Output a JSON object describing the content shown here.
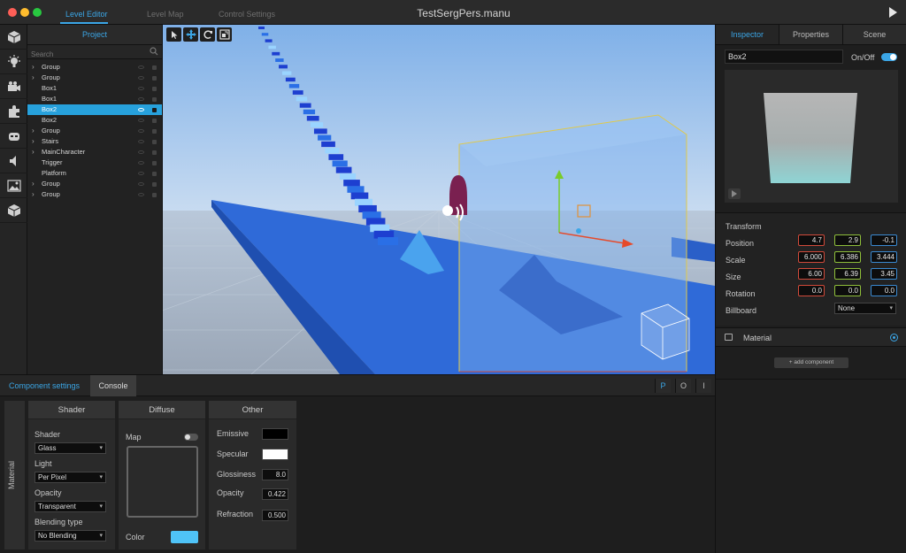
{
  "window": {
    "title": "TestSergPers.manu",
    "tabs": [
      "Level Editor",
      "Level Map",
      "Control Settings"
    ]
  },
  "project": {
    "header": "Project",
    "search_placeholder": "Search",
    "items": [
      {
        "label": "Group",
        "expandable": true
      },
      {
        "label": "Group",
        "expandable": true
      },
      {
        "label": "Box1",
        "expandable": false
      },
      {
        "label": "Box1",
        "expandable": false
      },
      {
        "label": "Box2",
        "expandable": false,
        "selected": true
      },
      {
        "label": "Box2",
        "expandable": false
      },
      {
        "label": "Group",
        "expandable": true
      },
      {
        "label": "Stairs",
        "expandable": true
      },
      {
        "label": "MainCharacter",
        "expandable": true
      },
      {
        "label": "Trigger",
        "expandable": false
      },
      {
        "label": "Platform",
        "expandable": false
      },
      {
        "label": "Group",
        "expandable": true
      },
      {
        "label": "Group",
        "expandable": true
      }
    ]
  },
  "inspector": {
    "tabs": [
      "Inspector",
      "Properties",
      "Scene"
    ],
    "object_name": "Box2",
    "onoff_label": "On/Off",
    "enabled": true,
    "transform": {
      "title": "Transform",
      "position_label": "Position",
      "scale_label": "Scale",
      "size_label": "Size",
      "rotation_label": "Rotation",
      "billboard_label": "Billboard",
      "position": [
        "4.7",
        "2.9",
        "-0.1"
      ],
      "scale": [
        "6.000",
        "6.386",
        "3.444"
      ],
      "size": [
        "6.00",
        "6.39",
        "3.45"
      ],
      "rotation": [
        "0.0",
        "0.0",
        "0.0"
      ],
      "billboard": "None"
    },
    "component": "Material",
    "add_component_label": "+ add component"
  },
  "bottom": {
    "tabs": [
      "Component settings",
      "Console"
    ],
    "modes": [
      "P",
      "O",
      "I"
    ],
    "side_label": "Material",
    "shader": {
      "header": "Shader",
      "shader_label": "Shader",
      "shader_value": "Glass",
      "light_label": "Light",
      "light_value": "Per Pixel",
      "opacity_label": "Opacity",
      "opacity_value": "Transparent",
      "blending_label": "Blending type",
      "blending_value": "No Blending"
    },
    "diffuse": {
      "header": "Diffuse",
      "map_label": "Map",
      "color_label": "Color",
      "color_value": "#4fc3f7"
    },
    "other": {
      "header": "Other",
      "emissive_label": "Emissive",
      "emissive_color": "#000000",
      "specular_label": "Specular",
      "specular_color": "#ffffff",
      "glossiness_label": "Glossiness",
      "glossiness_value": "8.0",
      "opacity_label": "Opacity",
      "opacity_value": "0.422",
      "refraction_label": "Refraction",
      "refraction_value": "0.500"
    }
  },
  "colors": {
    "accent": "#3ba6e6",
    "selection": "#27a1dc",
    "axis_x": "#d24a3a",
    "axis_y": "#8fbf3a",
    "axis_z": "#3a8ad2"
  }
}
